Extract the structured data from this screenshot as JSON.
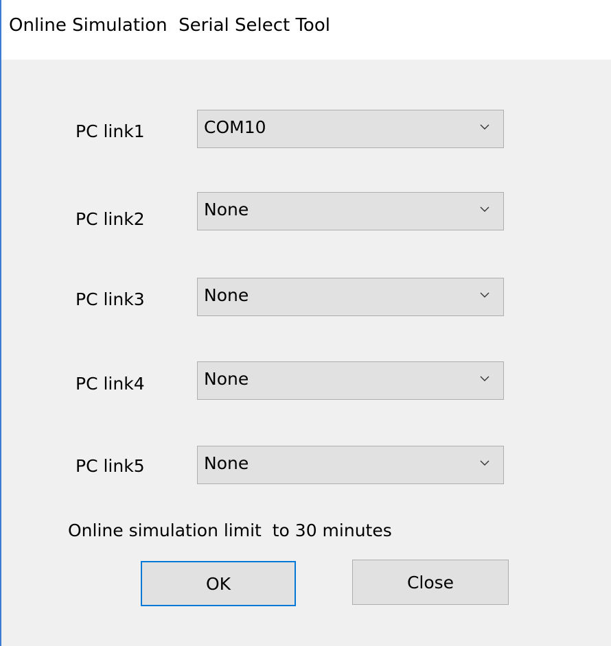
{
  "window": {
    "title": "Online Simulation  Serial Select Tool"
  },
  "links": [
    {
      "label": "PC link1",
      "value": "COM10"
    },
    {
      "label": "PC link2",
      "value": "None"
    },
    {
      "label": "PC link3",
      "value": "None"
    },
    {
      "label": "PC link4",
      "value": "None"
    },
    {
      "label": "PC link5",
      "value": "None"
    }
  ],
  "limit_text": "Online simulation limit  to 30 minutes",
  "buttons": {
    "ok": "OK",
    "close": "Close"
  },
  "colors": {
    "accent": "#0078d7",
    "window_border": "#3c7bd1",
    "button_face": "#e1e1e1"
  }
}
